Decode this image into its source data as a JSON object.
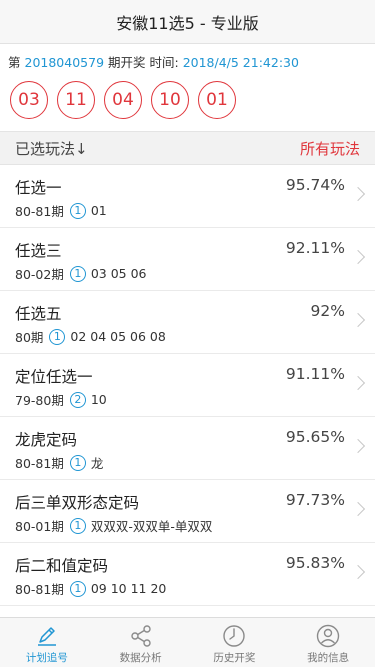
{
  "header": {
    "title": "安徽11选5 - 专业版"
  },
  "draw": {
    "prefix": "第",
    "issue": "2018040579",
    "middle": "期开奖 时间:",
    "time": "2018/4/5 21:42:30",
    "balls": [
      "03",
      "11",
      "04",
      "10",
      "01"
    ]
  },
  "section": {
    "left_label": "已选玩法↓",
    "right_label": "所有玩法"
  },
  "plays": [
    {
      "name": "任选一",
      "pct": "95.74%",
      "period": "80-81期",
      "badge": "1",
      "nums": "01"
    },
    {
      "name": "任选三",
      "pct": "92.11%",
      "period": "80-02期",
      "badge": "1",
      "nums": "03 05 06"
    },
    {
      "name": "任选五",
      "pct": "92%",
      "period": "80期",
      "badge": "1",
      "nums": "02 04 05 06 08"
    },
    {
      "name": "定位任选一",
      "pct": "91.11%",
      "period": "79-80期",
      "badge": "2",
      "nums": "10"
    },
    {
      "name": "龙虎定码",
      "pct": "95.65%",
      "period": "80-81期",
      "badge": "1",
      "nums": "龙"
    },
    {
      "name": "后三单双形态定码",
      "pct": "97.73%",
      "period": "80-01期",
      "badge": "1",
      "nums": "双双双-双双单-单双双"
    },
    {
      "name": "后二和值定码",
      "pct": "95.83%",
      "period": "80-81期",
      "badge": "1",
      "nums": "09 10 11 20"
    }
  ],
  "tabs": [
    {
      "label": "计划追号",
      "icon": "pencil-icon",
      "active": true
    },
    {
      "label": "数据分析",
      "icon": "share-icon",
      "active": false
    },
    {
      "label": "历史开奖",
      "icon": "clock-icon",
      "active": false
    },
    {
      "label": "我的信息",
      "icon": "user-icon",
      "active": false
    }
  ],
  "colors": {
    "accent_red": "#e0363c",
    "accent_blue": "#2196d3"
  }
}
